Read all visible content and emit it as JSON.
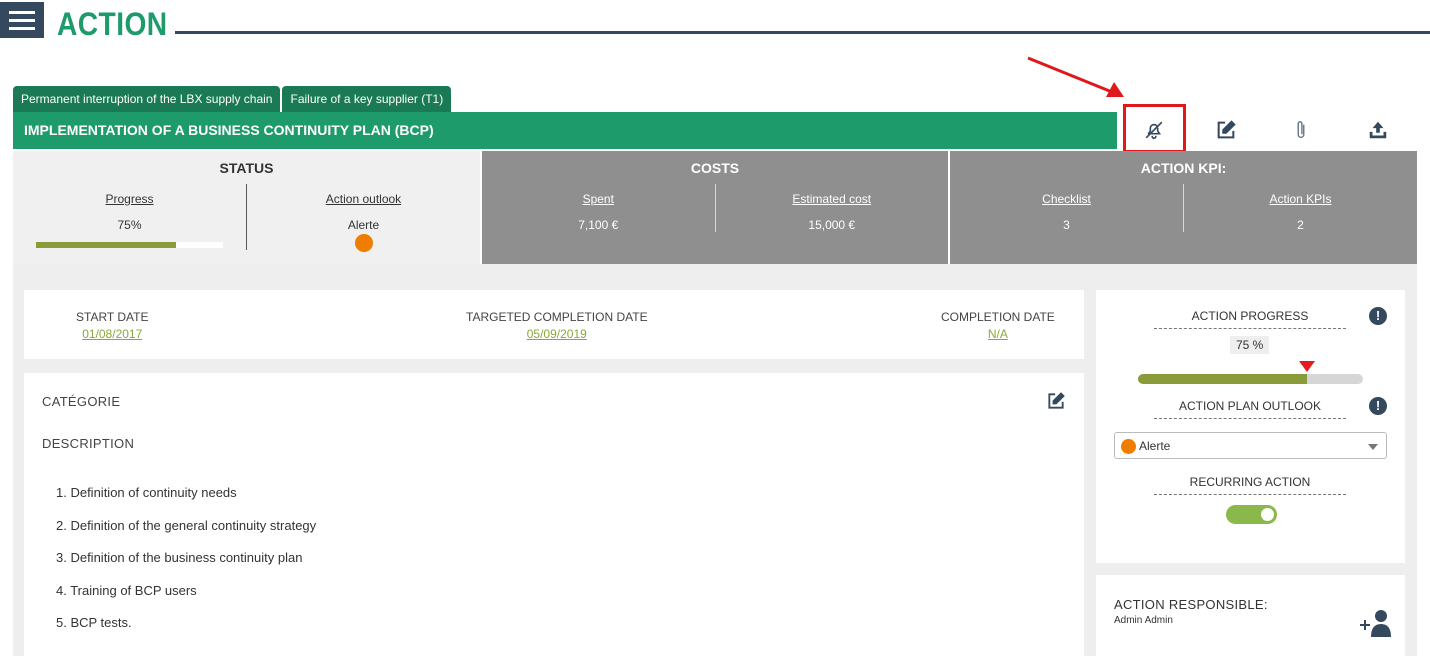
{
  "header": {
    "title": "ACTION"
  },
  "tabs": [
    {
      "label": "Permanent interruption of the LBX supply chain"
    },
    {
      "label": "Failure of a key supplier (T1)"
    }
  ],
  "banner": {
    "title": "IMPLEMENTATION OF A BUSINESS CONTINUITY PLAN (BCP)"
  },
  "toolbar": {
    "icons": [
      "bell-off-icon",
      "edit-icon",
      "paperclip-icon",
      "upload-icon"
    ]
  },
  "status": {
    "title": "STATUS",
    "progress_label": "Progress",
    "progress_value": "75%",
    "progress_fraction": 0.75,
    "outlook_label": "Action outlook",
    "outlook_value": "Alerte",
    "outlook_color": "#f07d00"
  },
  "costs": {
    "title": "COSTS",
    "spent_label": "Spent",
    "spent_value": "7,100 €",
    "estimated_label": "Estimated cost",
    "estimated_value": "15,000 €"
  },
  "kpi": {
    "title": "ACTION KPI:",
    "checklist_label": "Checklist",
    "checklist_value": "3",
    "kpis_label": "Action KPIs",
    "kpis_value": "2"
  },
  "dates": {
    "start_label": "START DATE",
    "start_value": "01/08/2017",
    "target_label": "TARGETED COMPLETION DATE",
    "target_value": "05/09/2019",
    "completion_label": "COMPLETION DATE",
    "completion_value": "N/A"
  },
  "description": {
    "category_label": "CATÉGORIE",
    "description_label": "DESCRIPTION",
    "items": [
      "1. Definition of continuity needs",
      "2. Definition of the general continuity strategy",
      "3. Definition of the business continuity plan",
      "4. Training of BCP users",
      "5. BCP tests."
    ]
  },
  "right_panel": {
    "action_progress_label": "ACTION PROGRESS",
    "action_progress_value": "75 %",
    "action_progress_fraction": 0.75,
    "outlook_label": "ACTION PLAN OUTLOOK",
    "outlook_selected": "Alerte",
    "outlook_color": "#f07d00",
    "recurring_label": "RECURRING ACTION",
    "recurring_on": true
  },
  "responsible": {
    "label": "ACTION RESPONSIBLE:",
    "value": "Admin Admin"
  },
  "colors": {
    "brand_green": "#1e9b6b",
    "tab_green": "#1a7a55",
    "dark_navy": "#34495e",
    "progress_olive": "#8a9b3a",
    "link_green": "#8aa83a",
    "highlight_red": "#e0181b"
  }
}
